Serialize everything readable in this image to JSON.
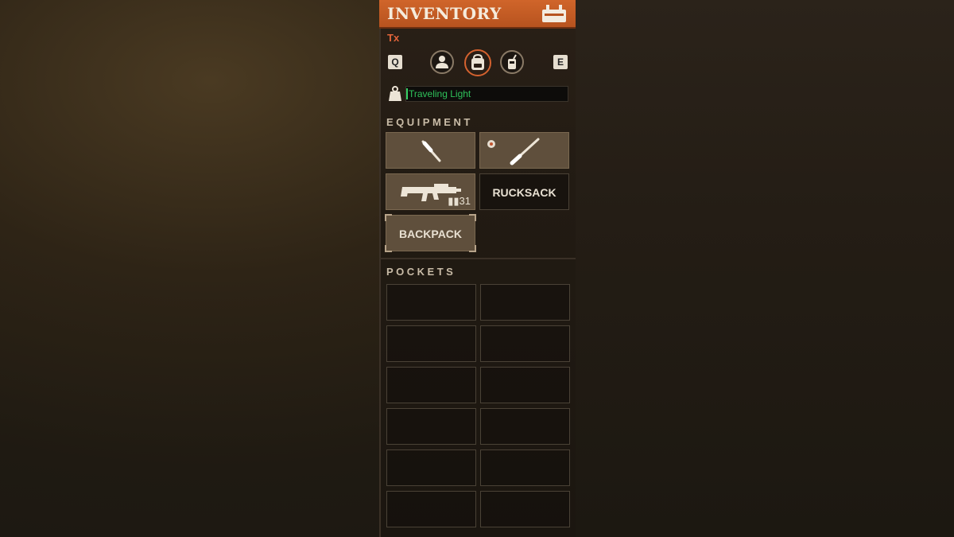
{
  "header": {
    "title": "INVENTORY",
    "icon": "backpack-icon"
  },
  "player": {
    "name": "Tx"
  },
  "tabs": {
    "prev_key": "Q",
    "next_key": "E",
    "items": [
      {
        "icon": "character-icon",
        "active": false
      },
      {
        "icon": "backpack-icon",
        "active": true
      },
      {
        "icon": "radio-icon",
        "active": false
      }
    ]
  },
  "weight": {
    "icon": "weight-icon",
    "status": "Traveling Light"
  },
  "equipment": {
    "title": "EQUIPMENT",
    "slots": [
      {
        "icon": "melee-weapon-icon"
      },
      {
        "icon": "long-melee-weapon-icon",
        "badge_icon": "crosshair-badge-icon"
      },
      {
        "icon": "assault-rifle-icon",
        "ammo": "31"
      },
      {
        "label": "RUCKSACK"
      },
      {
        "label": "BACKPACK"
      }
    ]
  },
  "pockets": {
    "title": "POCKETS",
    "slot_count": 12
  },
  "colors": {
    "accent": "#d0652a",
    "status_green": "#2fc15a",
    "player_name": "#e2643a"
  }
}
